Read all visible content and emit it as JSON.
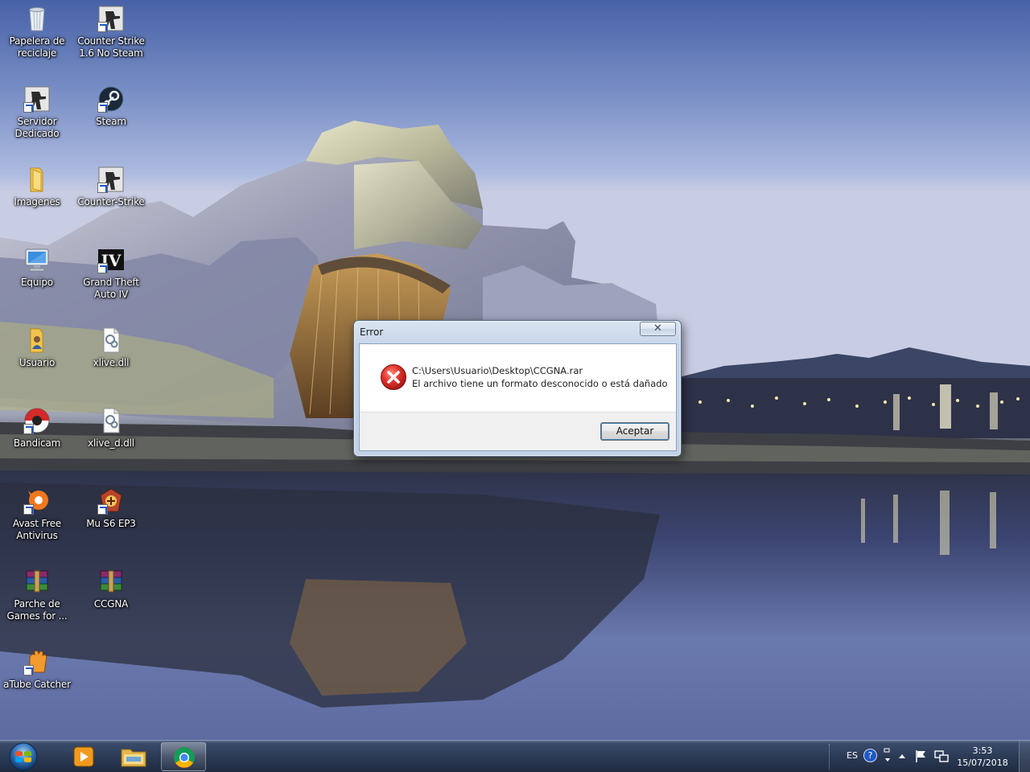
{
  "desktop": {
    "icons": [
      {
        "label": "Papelera de reciclaje",
        "icon": "recycle-bin-icon"
      },
      {
        "label": "Counter Strike 1.6 No Steam",
        "icon": "counter-strike-icon"
      },
      {
        "label": "Servidor Dedicado",
        "icon": "counter-strike-icon"
      },
      {
        "label": "Steam",
        "icon": "steam-icon"
      },
      {
        "label": "Imagenes",
        "icon": "folder-icon"
      },
      {
        "label": "Counter-Strike",
        "icon": "counter-strike-icon"
      },
      {
        "label": "Equipo",
        "icon": "computer-icon"
      },
      {
        "label": "Grand Theft Auto IV",
        "icon": "gta-icon"
      },
      {
        "label": "Usuario",
        "icon": "user-folder-icon"
      },
      {
        "label": "xlive.dll",
        "icon": "dll-file-icon"
      },
      {
        "label": "Bandicam",
        "icon": "bandicam-icon"
      },
      {
        "label": "xlive_d.dll",
        "icon": "dll-file-icon"
      },
      {
        "label": "Avast Free Antivirus",
        "icon": "avast-icon"
      },
      {
        "label": "Mu S6 EP3",
        "icon": "mu-online-icon"
      },
      {
        "label": "Parche de Games for ...",
        "icon": "winrar-icon"
      },
      {
        "label": "CCGNA",
        "icon": "winrar-icon"
      },
      {
        "label": "aTube Catcher",
        "icon": "atube-catcher-icon"
      }
    ]
  },
  "dialog": {
    "title": "Error",
    "close_label": "✕",
    "path": "C:\\Users\\Usuario\\Desktop\\CCGNA.rar",
    "message": "El archivo tiene un formato desconocido o está dañado",
    "accept_label": "Aceptar"
  },
  "taskbar": {
    "language": "ES",
    "time": "3:53",
    "date": "15/07/2018",
    "pinned": [
      {
        "name": "media-player-icon",
        "active": false
      },
      {
        "name": "file-explorer-icon",
        "active": false
      },
      {
        "name": "chrome-icon",
        "active": true
      }
    ]
  },
  "colors": {
    "error_red": "#d8282a",
    "link_blue": "#1f58c6",
    "taskbar": "#2a3953"
  }
}
